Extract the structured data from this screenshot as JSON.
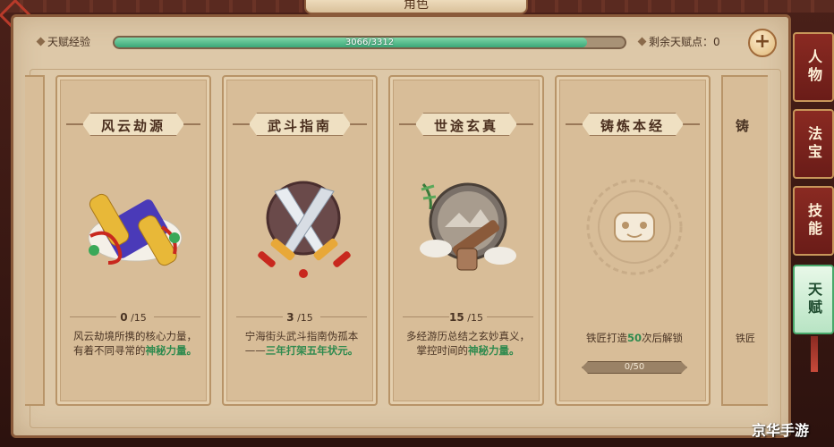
{
  "header": {
    "title": "角色"
  },
  "exp": {
    "label": "天赋经验",
    "value_text": "3066/3312",
    "current": 3066,
    "max": 3312,
    "remaining_label": "剩余天赋点：0",
    "add_symbol": "+"
  },
  "cards": [
    {
      "title": "风云劫源",
      "level_cur": "0",
      "level_max": "/15",
      "desc_plain": "风云劫境所携的核心力量，有着不同寻常的",
      "desc_green": "神秘力量。",
      "icon": "golden-scroll-icon"
    },
    {
      "title": "武斗指南",
      "level_cur": "3",
      "level_max": "/15",
      "desc_plain": "宁海街头武斗指南伪孤本——",
      "desc_green": "三年打架五年状元。",
      "icon": "crossed-swords-icon"
    },
    {
      "title": "世途玄真",
      "level_cur": "15",
      "level_max": "/15",
      "desc_plain": "多经游历总结之玄妙真义，掌控时间的",
      "desc_green": "神秘力量。",
      "icon": "scroll-emblem-icon"
    },
    {
      "title": "铸炼本经",
      "unlock_pre": "铁匠打造",
      "unlock_num": "50",
      "unlock_post": "次后解锁",
      "progress_text": "0/50",
      "progress": 0,
      "icon": "locked-emblem-icon"
    }
  ],
  "partial_right": {
    "title_frag": "铸",
    "desc_frag": "铁匠"
  },
  "side_tabs": [
    {
      "label": "人物",
      "active": false
    },
    {
      "label": "法宝",
      "active": false
    },
    {
      "label": "技能",
      "active": false
    },
    {
      "label": "天赋",
      "active": true
    }
  ],
  "watermark": "京华手游",
  "colors": {
    "parchment": "#ddc8a8",
    "accent_green": "#2e8a4e",
    "tab_red": "#8a2a22",
    "exp_green": "#3aa878"
  }
}
